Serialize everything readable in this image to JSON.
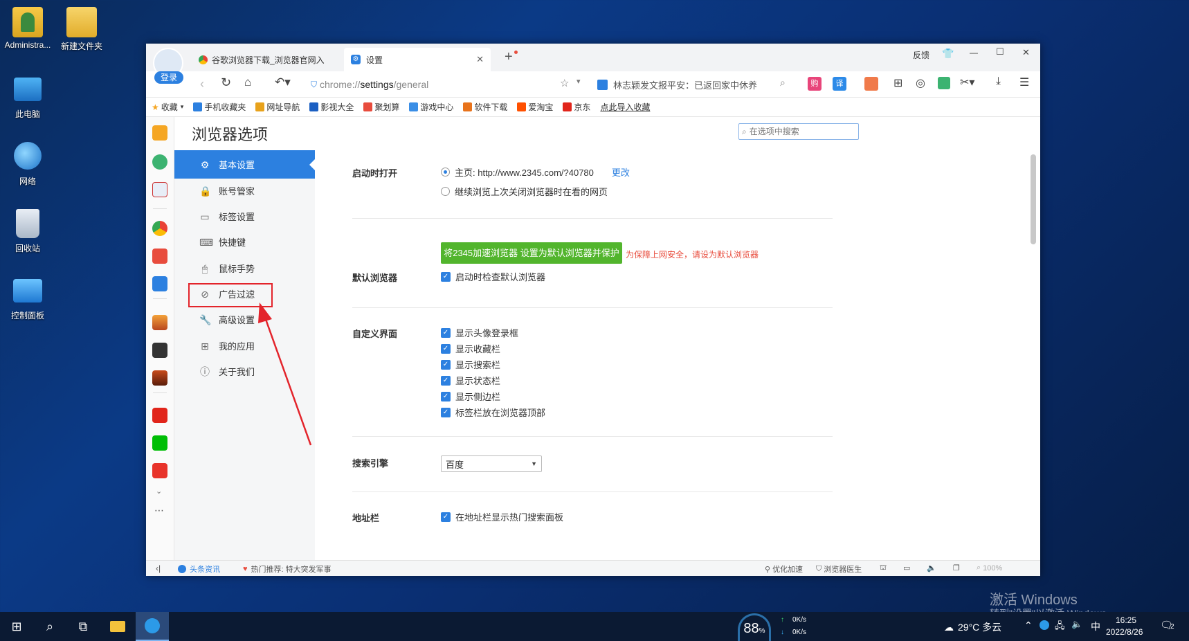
{
  "desktop": {
    "icons": [
      {
        "label": "Administra..."
      },
      {
        "label": "新建文件夹"
      },
      {
        "label": "此电脑"
      },
      {
        "label": "网络"
      },
      {
        "label": "回收站"
      },
      {
        "label": "控制面板"
      }
    ],
    "watermark": {
      "title": "激活 Windows",
      "subtitle": "转到\"设置\"以激活 Windows。"
    }
  },
  "browser": {
    "login_label": "登录",
    "tabs": [
      {
        "label": "谷歌浏览器下载_浏览器官网入"
      },
      {
        "label": "设置"
      }
    ],
    "new_tab": "+",
    "window_controls": {
      "feedback": "反馈",
      "minimize": "—",
      "maximize": "☐",
      "close": "✕"
    },
    "address": {
      "scheme": "chrome://",
      "host": "settings",
      "path": "/general"
    },
    "news_ticker": "林志颖发文报平安：已返回家中休养",
    "bookmarks": [
      {
        "label": "收藏",
        "color": "#f5a623"
      },
      {
        "label": "手机收藏夹",
        "color": "#2c80e0"
      },
      {
        "label": "网址导航",
        "color": "#e8a21b"
      },
      {
        "label": "影视大全",
        "color": "#1b5fc2"
      },
      {
        "label": "聚划算",
        "color": "#e84c3d"
      },
      {
        "label": "游戏中心",
        "color": "#3a8ee6"
      },
      {
        "label": "软件下载",
        "color": "#e8731b"
      },
      {
        "label": "爱淘宝",
        "color": "#ff5000"
      },
      {
        "label": "京东",
        "color": "#e1251b"
      },
      {
        "label": "点此导入收藏"
      }
    ]
  },
  "settings": {
    "page_title": "浏览器选项",
    "search_placeholder": "在选项中搜索",
    "nav": [
      {
        "label": "基本设置",
        "icon": "gear-icon",
        "glyph": "⚙"
      },
      {
        "label": "账号管家",
        "icon": "lock-icon",
        "glyph": "🔒"
      },
      {
        "label": "标签设置",
        "icon": "tabs-icon",
        "glyph": "▭"
      },
      {
        "label": "快捷键",
        "icon": "keyboard-icon",
        "glyph": "⌨"
      },
      {
        "label": "鼠标手势",
        "icon": "mouse-icon",
        "glyph": "🖱"
      },
      {
        "label": "广告过滤",
        "icon": "block-icon",
        "glyph": "⊘"
      },
      {
        "label": "高级设置",
        "icon": "wrench-icon",
        "glyph": "🔧"
      },
      {
        "label": "我的应用",
        "icon": "apps-icon",
        "glyph": "⊞"
      },
      {
        "label": "关于我们",
        "icon": "info-icon",
        "glyph": "ⓘ"
      }
    ],
    "startup": {
      "label": "启动时打开",
      "option_home": "主页: http://www.2345.com/?40780",
      "change_link": "更改",
      "option_continue": "继续浏览上次关闭浏览器时在看的网页"
    },
    "default_browser": {
      "label": "默认浏览器",
      "button": "将2345加速浏览器 设置为默认浏览器并保护",
      "warning": "为保障上网安全，请设为默认浏览器",
      "check_label": "启动时检查默认浏览器"
    },
    "custom_ui": {
      "label": "自定义界面",
      "options": [
        "显示头像登录框",
        "显示收藏栏",
        "显示搜索栏",
        "显示状态栏",
        "显示侧边栏",
        "标签栏放在浏览器顶部"
      ]
    },
    "search_engine": {
      "label": "搜索引擎",
      "value": "百度"
    },
    "address_bar": {
      "label": "地址栏",
      "check_label": "在地址栏显示热门搜索面板"
    }
  },
  "statusbar": {
    "news_label": "头条资讯",
    "hot_label": "热门推荐: 特大突发军事",
    "optimize": "优化加速",
    "doctor": "浏览器医生",
    "zoom": "100%"
  },
  "taskbar": {
    "cpu_percent": "88",
    "net_up": "0K/s",
    "net_down": "0K/s",
    "weather": "29°C 多云",
    "ime": "中",
    "time": "16:25",
    "date": "2022/8/26",
    "notifications": "2"
  },
  "colors": {
    "accent": "#2c80e0",
    "green_button": "#52b52d",
    "warning": "#e84c3d",
    "annotation": "#e3242b"
  }
}
